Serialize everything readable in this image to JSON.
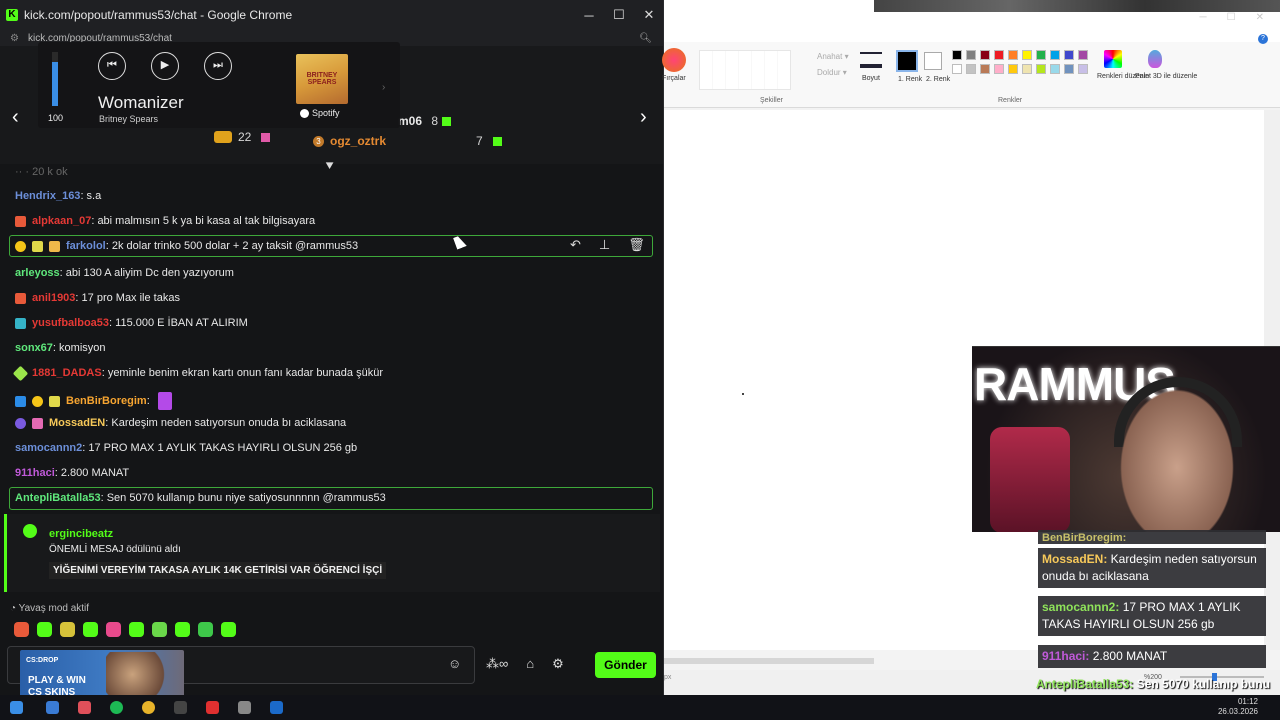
{
  "chrome": {
    "title": "kick.com/popout/rammus53/chat - Google Chrome",
    "url": "kick.com/popout/rammus53/chat",
    "minimize": "─",
    "maximize": "☐",
    "close": "✕",
    "favicon": "K"
  },
  "spotify": {
    "song": "Womanizer",
    "artist": "Britney Spears",
    "volume": 100,
    "volume_label": "100",
    "volume_fraction": 0.82,
    "source_label": "Spotify",
    "album_text": "BRITNEY SPEARS",
    "prev": "⏮",
    "play": "▶",
    "next": "⏭",
    "next_page": "›"
  },
  "leaderboard": {
    "top_partial": "r",
    "first_count": "22",
    "second_rank": "3",
    "second_user": "ogz_oztrk",
    "second_count": "7",
    "third_user": "m06",
    "third_count": "8"
  },
  "chat": {
    "partial_top": "·· · 20 k ok",
    "messages": [
      {
        "user": "Hendrix_163",
        "text": ": s.a",
        "color": "#6c8fd9"
      },
      {
        "user": "alpkaan_07",
        "text": ": abi malmısın 5 k ya bi kasa al tak bilgisayara",
        "color": "#e53935"
      },
      {
        "user": "farkolol",
        "text": ": 2k dolar trinko 500 dolar + 2 ay taksit @rammus53",
        "color": "#6c8fd9"
      },
      {
        "user": "arleyoss",
        "text": ": abi 130 A aliyim Dc den yazıyorum",
        "color": "#5fe87c"
      },
      {
        "user": "anil1903",
        "text": ": 17 pro Max ile takas",
        "color": "#e53935"
      },
      {
        "user": "yusufbalboa53",
        "text": ": 115.000 E İBAN AT ALIRIM",
        "color": "#e53935"
      },
      {
        "user": "sonx67",
        "text": ": komisyon",
        "color": "#5fe87c"
      },
      {
        "user": "1881_DADAS",
        "text": ": yeminle benim ekran kartı onun fanı kadar bunada şükür",
        "color": "#e53935"
      },
      {
        "user": "BenBirBoregim",
        "text": ":",
        "color": "#f7a531"
      },
      {
        "user": "MossadEN",
        "text": ": Kardeşim neden satıyorsun onuda bı aciklasana",
        "color": "#f7c95a"
      },
      {
        "user": "samocannn2",
        "text": ": 17 PRO MAX 1 AYLIK TAKAS HAYIRLI OLSUN 256 gb",
        "color": "#6c8fd9"
      },
      {
        "user": "911haci",
        "text": ": 2.800 MANAT",
        "color": "#c05ad9"
      },
      {
        "user": "AntepliBatalla53",
        "text": ": Sen 5070 kullanıp bunu niye satiyosunnnnn @rammus53",
        "color": "#5fe87c"
      }
    ],
    "redeem": {
      "user": "ergincibeatz",
      "title": "ÖNEMLİ MESAJ ödülünü aldı",
      "message": "YİĞENİMİ VEREYİM TAKASA AYLIK 14K GETİRİSİ VAR ÖĞRENCİ İŞÇİ"
    },
    "slow_mode": "Yavaş mod aktif",
    "send_label": "Gönder",
    "input_placeholder": ""
  },
  "ad": {
    "line1": "CS:DROP",
    "line2": "PLAY & WIN",
    "line3": "CS SKINS"
  },
  "paint": {
    "fircalar": "Fırçalar",
    "anahat": "Anahat ▾",
    "doldur": "Doldur ▾",
    "sekiller": "Şekiller",
    "boyut": "Boyut",
    "renk1": "1. Renk",
    "renk2": "2. Renk",
    "renkler": "Renkler",
    "edit_colors": "Renkleri düzenle",
    "paint3d": "Paint 3D ile düzenle",
    "px_unit": "px",
    "zoom": "%200"
  },
  "overlay": {
    "partial_user": "BenBirBoregim:",
    "card1_user": "MossadEN:",
    "card1_text": " Kardeşim neden satıyorsun onuda bı aciklasana",
    "card2_user": "samocannn2:",
    "card2_text": " 17 PRO MAX 1 AYLIK TAKAS HAYIRLI OLSUN 256 gb",
    "card3_user": "911haci:",
    "card3_text": " 2.800 MANAT",
    "bottom_user": "AntepliBatalla53:",
    "bottom_text": " Sen 5070 kullanıp bunu niye satiyosunnnnn @rammus53",
    "webcam_brand": "RAMMUS"
  },
  "taskbar": {
    "time": "01:12",
    "date": "26.03.2026"
  },
  "colors": {
    "kick_green": "#53fc18",
    "highlight_border": "#3ea83a"
  }
}
